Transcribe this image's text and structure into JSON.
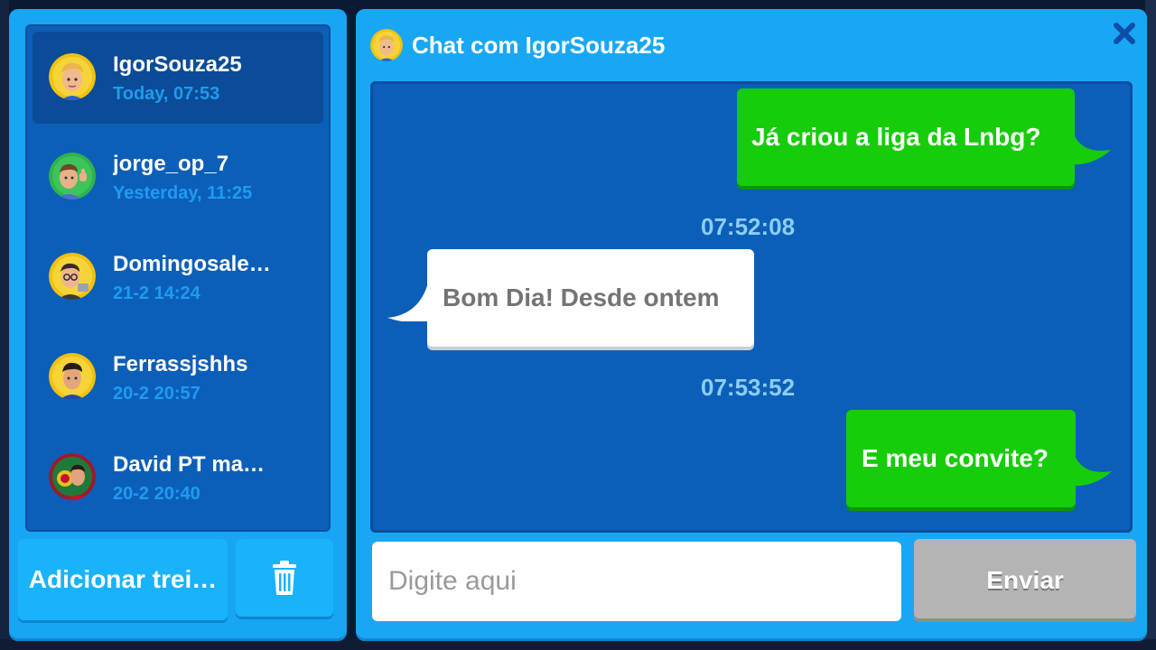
{
  "contacts": [
    {
      "name": "IgorSouza25",
      "time": "Today, 07:53",
      "avatar": "avatar-blond-player",
      "active": true
    },
    {
      "name": "jorge_op_7",
      "time": "Yesterday, 11:25",
      "avatar": "avatar-thumbs-up-player",
      "active": false
    },
    {
      "name": "Domingosale…",
      "time": "21-2 14:24",
      "avatar": "avatar-glasses-player",
      "active": false
    },
    {
      "name": "Ferrassjshhs",
      "time": "20-2 20:57",
      "avatar": "avatar-dark-hair-player",
      "active": false
    },
    {
      "name": "David PT ma…",
      "time": "20-2 20:40",
      "avatar": "avatar-portugal-player",
      "active": false
    }
  ],
  "actions": {
    "add_label": "Adicionar trei…",
    "delete_icon": "trash-icon"
  },
  "chat": {
    "title": "Chat com IgorSouza25",
    "close_icon": "close-icon",
    "messages": [
      {
        "from": "me",
        "text": "Já criou a liga da Lnbg?"
      },
      {
        "timestamp": "07:52:08"
      },
      {
        "from": "them",
        "text": "Bom Dia! Desde ontem"
      },
      {
        "timestamp": "07:53:52"
      },
      {
        "from": "me",
        "text": "E meu convite?"
      }
    ],
    "input_placeholder": "Digite aqui",
    "send_label": "Enviar"
  },
  "colors": {
    "panel": "#19a7f5",
    "list_bg": "#0c5fb9",
    "outgoing_bubble": "#17cc0b",
    "incoming_bubble": "#ffffff",
    "timestamp": "#8ccdf7",
    "send_disabled": "#b4b4b4"
  }
}
